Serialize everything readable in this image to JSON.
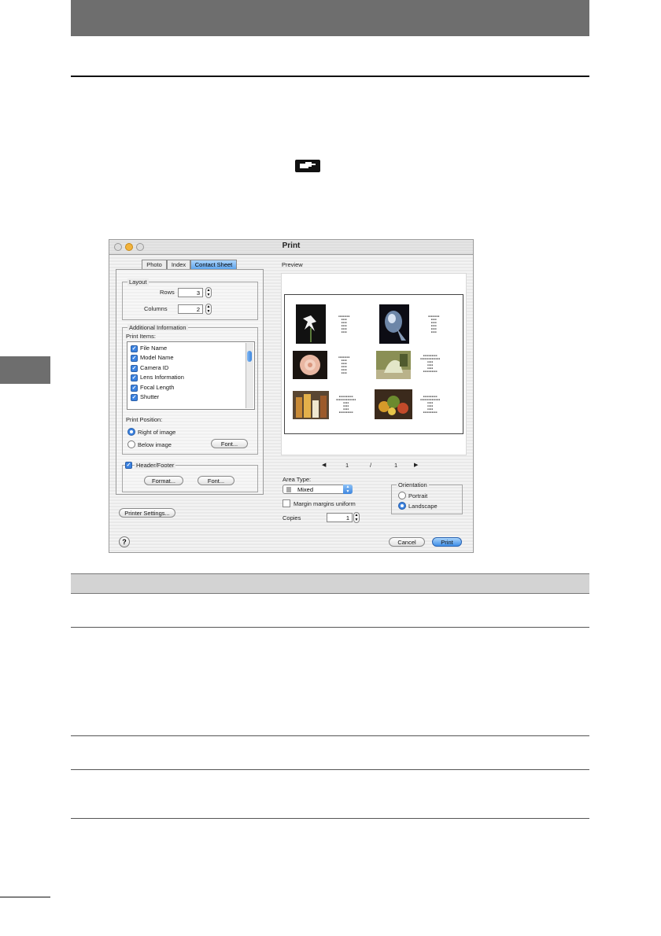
{
  "dialog": {
    "title": "Print",
    "tabs": [
      {
        "label": "Photo"
      },
      {
        "label": "Index"
      },
      {
        "label": "Contact Sheet"
      }
    ],
    "layout": {
      "group_title": "Layout",
      "rows_label": "Rows",
      "rows_value": "3",
      "columns_label": "Columns",
      "columns_value": "2"
    },
    "additional": {
      "group_title": "Additional Information",
      "print_items_label": "Print Items:",
      "items": [
        {
          "label": "File Name",
          "checked": true
        },
        {
          "label": "Model Name",
          "checked": true
        },
        {
          "label": "Camera ID",
          "checked": true
        },
        {
          "label": "Lens Information",
          "checked": true
        },
        {
          "label": "Focal Length",
          "checked": true
        },
        {
          "label": "Shutter",
          "checked": true
        }
      ],
      "print_position_label": "Print Position:",
      "right_of_image": "Right of image",
      "below_image": "Below image",
      "font_button": "Font..."
    },
    "header_footer": {
      "label": "Header/Footer",
      "format_button": "Format...",
      "font_button": "Font..."
    },
    "printer_settings_button": "Printer Settings...",
    "preview_label": "Preview",
    "page_indicator": {
      "current": "1",
      "separator": "/",
      "total": "1"
    },
    "area_type_label": "Area Type:",
    "area_type_value": "Mixed",
    "margin_label": "Margin margins uniform",
    "copies_label": "Copies",
    "copies_value": "1",
    "orientation": {
      "title": "Orientation",
      "portrait": "Portrait",
      "landscape": "Landscape",
      "selected": "Landscape"
    },
    "cancel_button": "Cancel",
    "print_button": "Print",
    "help_symbol": "?"
  }
}
